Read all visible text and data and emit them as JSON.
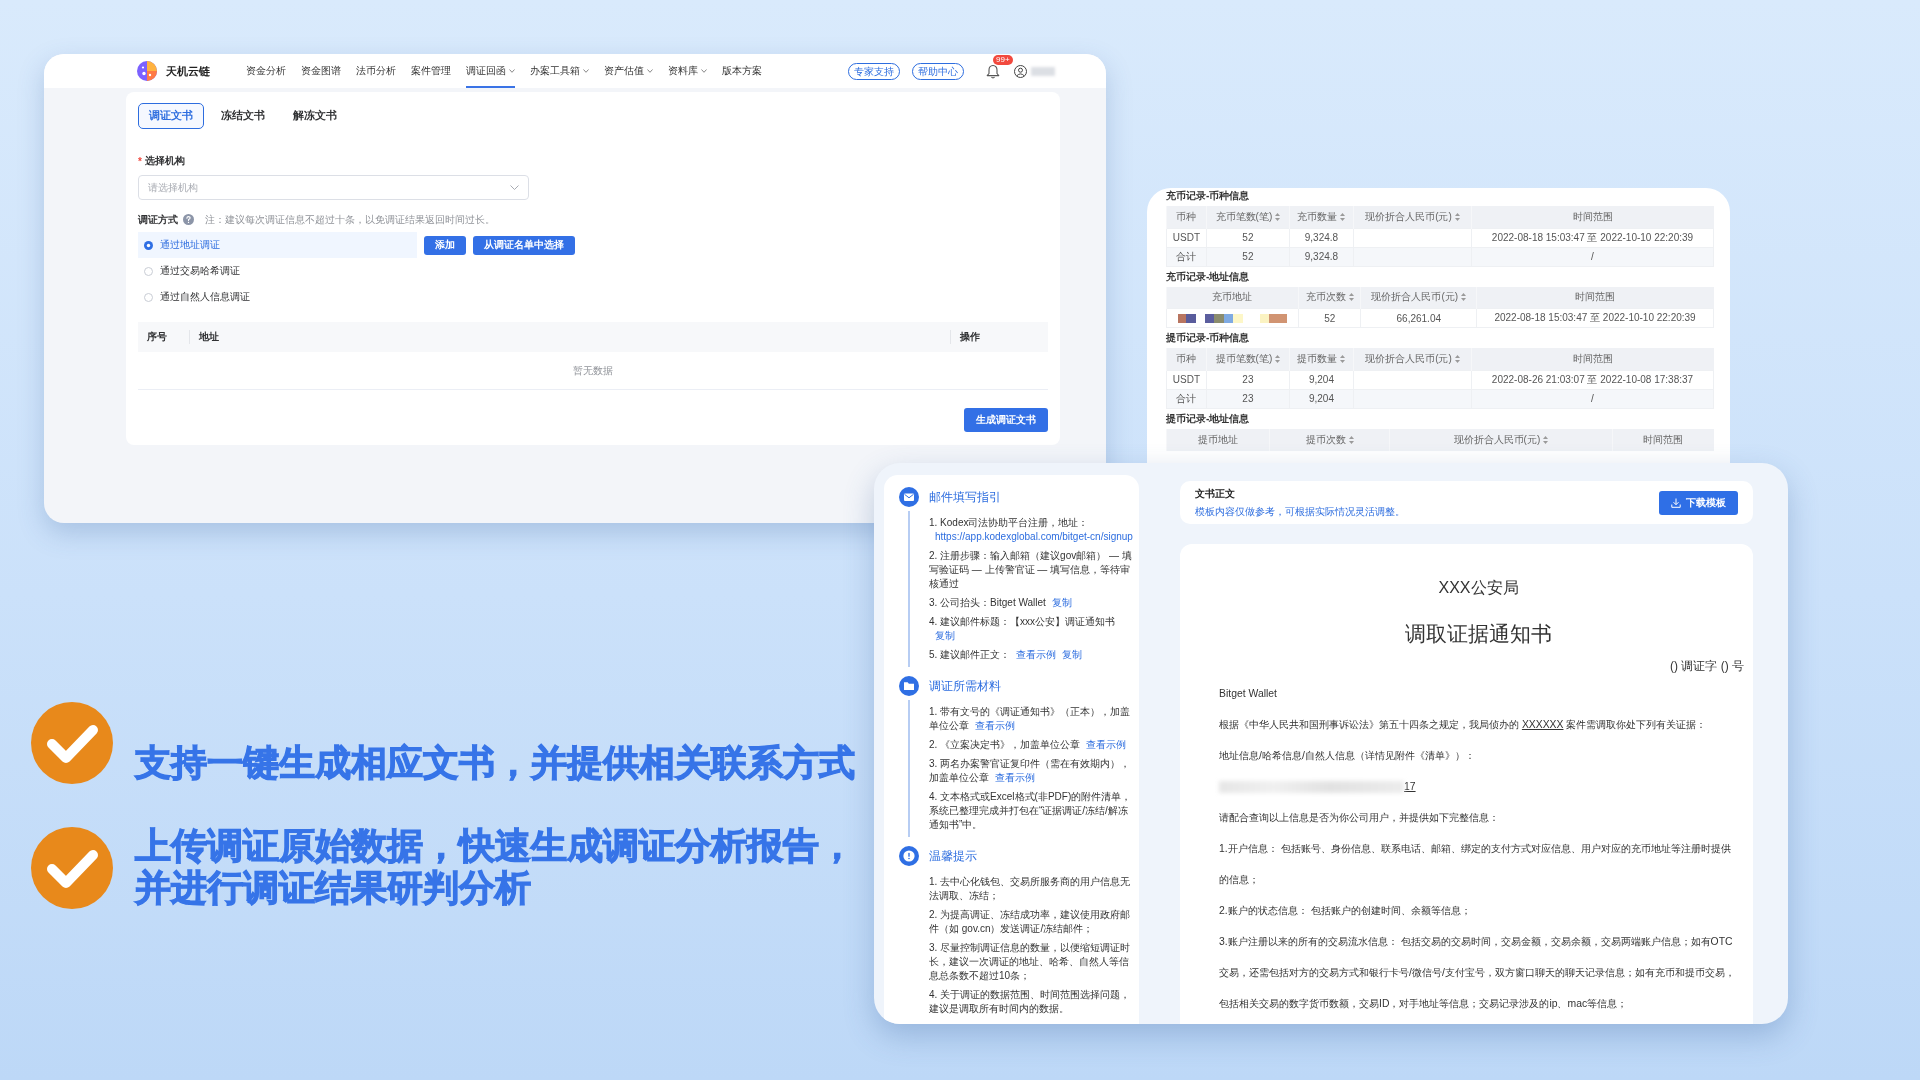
{
  "app_window": {
    "brand": "天机云链",
    "nav": [
      {
        "label": "资金分析",
        "selected": false,
        "dropdown": false
      },
      {
        "label": "资金图谱",
        "selected": false,
        "dropdown": false
      },
      {
        "label": "法币分析",
        "selected": false,
        "dropdown": false
      },
      {
        "label": "案件管理",
        "selected": false,
        "dropdown": false
      },
      {
        "label": "调证回函",
        "selected": true,
        "dropdown": true
      },
      {
        "label": "办案工具箱",
        "selected": false,
        "dropdown": true
      },
      {
        "label": "资产估值",
        "selected": false,
        "dropdown": true
      },
      {
        "label": "资料库",
        "selected": false,
        "dropdown": true
      },
      {
        "label": "版本方案",
        "selected": false,
        "dropdown": false
      }
    ],
    "header_buttons": [
      "专家支持",
      "帮助中心"
    ],
    "notifications": {
      "badge": "99+"
    },
    "tabs": [
      {
        "label": "调证文书",
        "selected": true
      },
      {
        "label": "冻结文书",
        "selected": false
      },
      {
        "label": "解冻文书",
        "selected": false
      }
    ],
    "institution": {
      "mark": "*",
      "label": "选择机构",
      "placeholder": "请选择机构"
    },
    "method": {
      "label": "调证方式",
      "note": "注：建议每次调证信息不超过十条，以免调证结果返回时间过长。",
      "options": [
        {
          "label": "通过地址调证",
          "selected": true
        },
        {
          "label": "通过交易哈希调证",
          "selected": false
        },
        {
          "label": "通过自然人信息调证",
          "selected": false
        }
      ],
      "actions": [
        "添加",
        "从调证名单中选择"
      ]
    },
    "table": {
      "columns": [
        "序号",
        "地址",
        "操作"
      ],
      "empty_text": "暂无数据"
    },
    "submit": "生成调证文书"
  },
  "report_window": {
    "sections": [
      {
        "title": "充币记录-币种信息",
        "columns": [
          {
            "label": "币种",
            "sortable": false
          },
          {
            "label": "充币笔数(笔)",
            "sortable": true
          },
          {
            "label": "充币数量",
            "sortable": true
          },
          {
            "label": "现价折合人民币(元)",
            "sortable": true
          },
          {
            "label": "时间范围",
            "sortable": false
          }
        ],
        "rows": [
          [
            "USDT",
            "52",
            "9,324.8",
            null,
            "2022-08-18 15:03:47 至 2022-10-10 22:20:39"
          ],
          [
            "合计",
            "52",
            "9,324.8",
            null,
            "/"
          ]
        ]
      },
      {
        "title": "充币记录-地址信息",
        "columns": [
          {
            "label": "充币地址",
            "sortable": false
          },
          {
            "label": "充币次数",
            "sortable": true
          },
          {
            "label": "现价折合人民币(元)",
            "sortable": true
          },
          {
            "label": "时间范围",
            "sortable": false
          }
        ],
        "rows": [
          [
            {
              "kind": "mosaic"
            },
            "52",
            "66,261.04",
            "2022-08-18 15:03:47 至 2022-10-10 22:20:39"
          ]
        ]
      },
      {
        "title": "提币记录-币种信息",
        "columns": [
          {
            "label": "币种",
            "sortable": false
          },
          {
            "label": "提币笔数(笔)",
            "sortable": true
          },
          {
            "label": "提币数量",
            "sortable": true
          },
          {
            "label": "现价折合人民币(元)",
            "sortable": true
          },
          {
            "label": "时间范围",
            "sortable": false
          }
        ],
        "rows": [
          [
            "USDT",
            "23",
            "9,204",
            null,
            "2022-08-26 21:03:07 至 2022-10-08 17:38:37"
          ],
          [
            "合计",
            "23",
            "9,204",
            null,
            "/"
          ]
        ]
      },
      {
        "title": "提币记录-地址信息",
        "columns": [
          {
            "label": "提币地址",
            "sortable": false
          },
          {
            "label": "提币次数",
            "sortable": true
          },
          {
            "label": "现价折合人民币(元)",
            "sortable": true
          },
          {
            "label": "时间范围",
            "sortable": false
          }
        ]
      }
    ]
  },
  "guide_window": {
    "steps": [
      {
        "kind": "mail",
        "title": "邮件填写指引",
        "items": [
          {
            "text": "1. Kodex司法协助平台注册，地址：",
            "links": [
              "https://app.kodexglobal.com/bitget-cn/signup"
            ]
          },
          {
            "text": "2. 注册步骤：输入邮箱（建议gov邮箱） — 填写验证码 — 上传警官证 — 填写信息，等待审核通过"
          },
          {
            "text": "3. 公司抬头：Bitget Wallet",
            "links": [
              "复制"
            ]
          },
          {
            "text": "4. 建议邮件标题：【xxx公安】调证通知书",
            "links": [
              "复制"
            ]
          },
          {
            "text": "5. 建议邮件正文：",
            "links": [
              "查看示例",
              "复制"
            ]
          }
        ]
      },
      {
        "kind": "materials",
        "title": "调证所需材料",
        "items": [
          {
            "text": "1. 带有文号的《调证通知书》（正本），加盖单位公章",
            "links": [
              "查看示例"
            ]
          },
          {
            "text": "2. 《立案决定书》，加盖单位公章",
            "links": [
              "查看示例"
            ]
          },
          {
            "text": "3. 两名办案警官证复印件（需在有效期内），加盖单位公章",
            "links": [
              "查看示例"
            ]
          },
          {
            "text": "4. 文本格式或Excel格式(非PDF)的附件清单，系统已整理完成并打包在“证据调证/冻结/解冻通知书”中。"
          }
        ]
      },
      {
        "kind": "tips",
        "title": "温馨提示",
        "items": [
          {
            "text": "1. 去中心化钱包、交易所服务商的用户信息无法调取、冻结；"
          },
          {
            "text": "2. 为提高调证、冻结成功率，建议使用政府邮件（如 gov.cn）发送调证/冻结邮件；"
          },
          {
            "text": "3. 尽量控制调证信息的数量，以便缩短调证时长，建议一次调证的地址、哈希、自然人等信息总条数不超过10条；"
          },
          {
            "text": "4. 关于调证的数据范围、时间范围选择问题，建议是调取所有时间内的数据。"
          }
        ]
      }
    ],
    "template": {
      "title": "文书正文",
      "note": "模板内容仅做参考，可根据实际情况灵活调整。",
      "button": "下载模板"
    },
    "document": {
      "authority": "XXX公安局",
      "title": "调取证据通知书",
      "number": "() 调证字 () 号",
      "recipient": "Bitget Wallet",
      "basis": {
        "before": "根据《中华人民共和国刑事诉讼法》第五十四条之规定，我局侦办的 ",
        "case": "XXXXXX",
        "after": " 案件需调取你处下列有关证据："
      },
      "evidence_label": "地址信息/哈希信息/自然人信息（详情见附件《清单》）：",
      "address_tail": "17",
      "request": "请配合查询以上信息是否为你公司用户，并提供如下完整信息：",
      "items": [
        "1.开户信息： 包括账号、身份信息、联系电话、邮箱、绑定的支付方式对应信息、用户对应的充币地址等注册时提供的信息；",
        "2.账户的状态信息： 包括账户的创建时间、余额等信息；",
        "3.账户注册以来的所有的交易流水信息： 包括交易的交易时间，交易金额，交易余额，交易两端账户信息；如有OTC交易，还需包括对方的交易方式和银行卡号/微信号/支付宝号，双方窗口聊天的聊天记录信息；如有充币和提币交易，包括相关交易的数字货币数额，交易ID，对手地址等信息；交易记录涉及的ip、mac等信息；"
      ]
    }
  },
  "features": [
    {
      "lines": [
        "支持一键生成相应文书，并提供相关联系方式"
      ]
    },
    {
      "lines": [
        "上传调证原始数据，快速生成调证分析报告，",
        "并进行调证结果研判分析"
      ]
    }
  ]
}
